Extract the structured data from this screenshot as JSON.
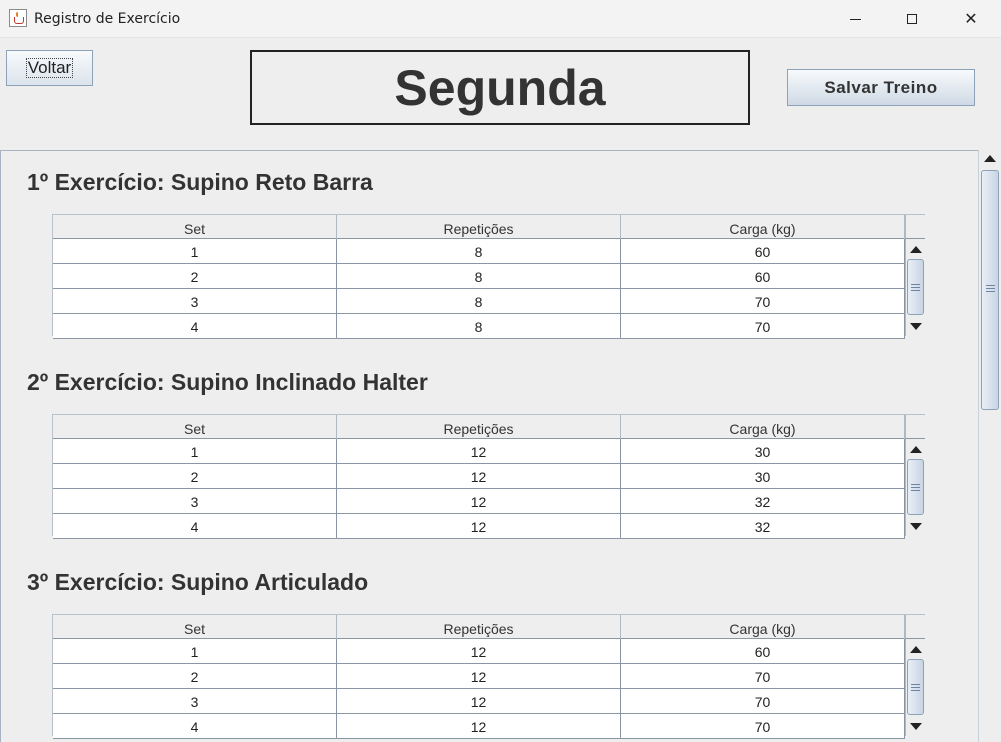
{
  "window": {
    "title": "Registro de Exercício"
  },
  "header": {
    "back_label": "Voltar",
    "day": "Segunda",
    "save_label": "Salvar Treino"
  },
  "columns": [
    "Set",
    "Repetições",
    "Carga (kg)"
  ],
  "exercises": [
    {
      "title": "1º Exercício: Supino Reto Barra",
      "rows": [
        [
          "1",
          "8",
          "60"
        ],
        [
          "2",
          "8",
          "60"
        ],
        [
          "3",
          "8",
          "70"
        ],
        [
          "4",
          "8",
          "70"
        ]
      ]
    },
    {
      "title": "2º Exercício: Supino Inclinado Halter",
      "rows": [
        [
          "1",
          "12",
          "30"
        ],
        [
          "2",
          "12",
          "30"
        ],
        [
          "3",
          "12",
          "32"
        ],
        [
          "4",
          "12",
          "32"
        ]
      ]
    },
    {
      "title": "3º Exercício: Supino Articulado",
      "rows": [
        [
          "1",
          "12",
          "60"
        ],
        [
          "2",
          "12",
          "70"
        ],
        [
          "3",
          "12",
          "70"
        ],
        [
          "4",
          "12",
          "70"
        ]
      ]
    }
  ]
}
